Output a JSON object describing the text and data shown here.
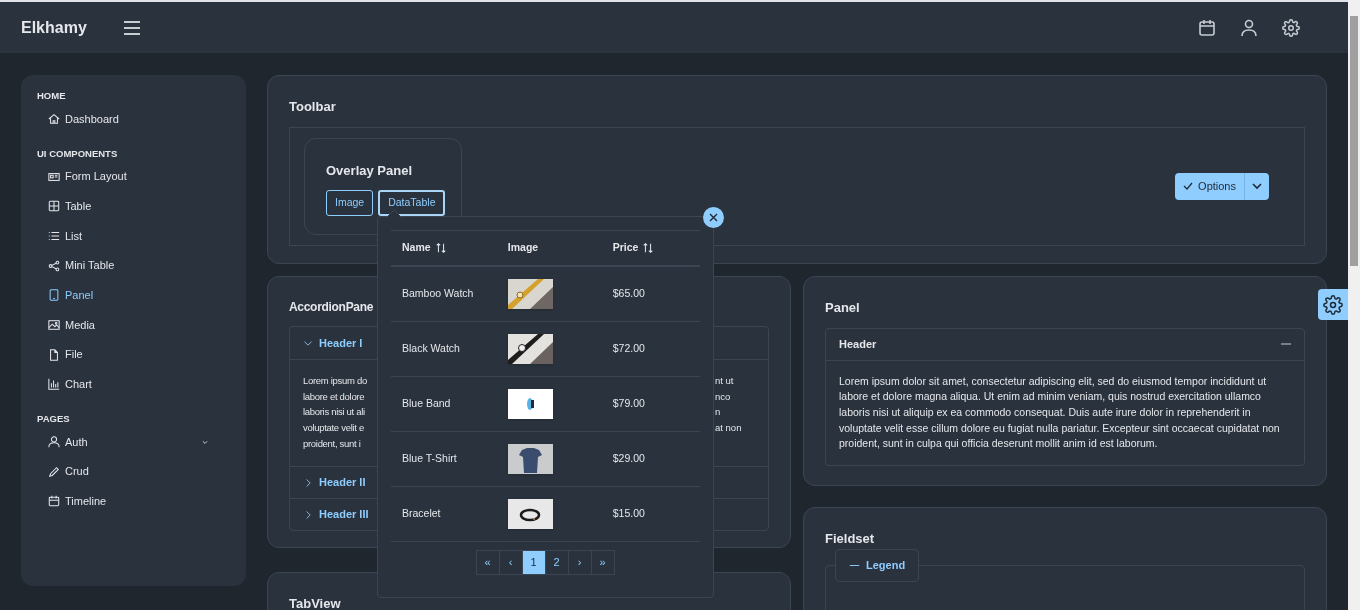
{
  "topbar": {
    "brand": "Elkhamy"
  },
  "sidebar": {
    "sections": [
      {
        "title": "HOME",
        "items": [
          {
            "label": "Dashboard",
            "selected": false
          }
        ]
      },
      {
        "title": "UI COMPONENTS",
        "items": [
          {
            "label": "Form Layout",
            "selected": false
          },
          {
            "label": "Table",
            "selected": false
          },
          {
            "label": "List",
            "selected": false
          },
          {
            "label": "Mini Table",
            "selected": false
          },
          {
            "label": "Panel",
            "selected": true
          },
          {
            "label": "Media",
            "selected": false
          },
          {
            "label": "File",
            "selected": false
          },
          {
            "label": "Chart",
            "selected": false
          }
        ]
      },
      {
        "title": "PAGES",
        "items": [
          {
            "label": "Auth",
            "selected": false,
            "expanded": false
          },
          {
            "label": "Crud",
            "selected": false
          },
          {
            "label": "Timeline",
            "selected": false
          }
        ]
      }
    ]
  },
  "toolbar": {
    "title": "Toolbar",
    "overlay_panel": {
      "title": "Overlay Panel",
      "buttons": [
        {
          "label": "Image",
          "selected": false
        },
        {
          "label": "DataTable",
          "selected": true
        }
      ]
    },
    "split_button": {
      "label": "Options"
    }
  },
  "overlay": {
    "columns": [
      {
        "label": "Name",
        "sortable": true
      },
      {
        "label": "Image",
        "sortable": false
      },
      {
        "label": "Price",
        "sortable": true
      }
    ],
    "rows": [
      {
        "name": "Bamboo Watch",
        "price": "$65.00"
      },
      {
        "name": "Black Watch",
        "price": "$72.00"
      },
      {
        "name": "Blue Band",
        "price": "$79.00"
      },
      {
        "name": "Blue T-Shirt",
        "price": "$29.00"
      },
      {
        "name": "Bracelet",
        "price": "$15.00"
      }
    ],
    "paginator": {
      "first": "«",
      "prev": "‹",
      "pages": [
        {
          "label": "1",
          "selected": true
        },
        {
          "label": "2",
          "selected": false
        }
      ],
      "next": "›",
      "last": "»"
    }
  },
  "accordion": {
    "title": "AccordionPane",
    "tabs": [
      {
        "header": "Header I",
        "expanded": true,
        "content_left": [
          "Lorem ipsum do",
          "labore et dolore",
          "laboris nisi ut ali",
          "voluptate velit e",
          "proident, sunt i"
        ],
        "content_right": [
          "nt ut",
          "nco",
          "n",
          "at non"
        ]
      },
      {
        "header": "Header II",
        "expanded": false
      },
      {
        "header": "Header III",
        "expanded": false
      }
    ]
  },
  "tabview": {
    "title": "TabView"
  },
  "panel": {
    "title": "Panel",
    "header": "Header",
    "collapsed": false,
    "content": "Lorem ipsum dolor sit amet, consectetur adipiscing elit, sed do eiusmod tempor incididunt ut labore et dolore magna aliqua. Ut enim ad minim veniam, quis nostrud exercitation ullamco laboris nisi ut aliquip ex ea commodo consequat. Duis aute irure dolor in reprehenderit in voluptate velit esse cillum dolore eu fugiat nulla pariatur. Excepteur sint occaecat cupidatat non proident, sunt in culpa qui officia deserunt mollit anim id est laborum."
  },
  "fieldset": {
    "title": "Fieldset",
    "legend": "Legend",
    "collapsed": false
  }
}
